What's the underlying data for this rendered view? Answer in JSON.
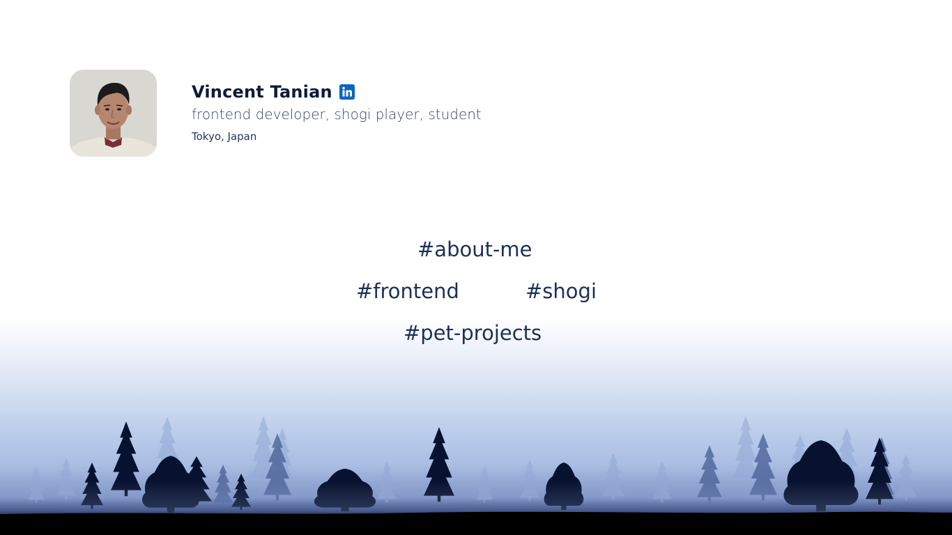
{
  "profile": {
    "name": "Vincent Tanian",
    "subtitle": "frontend developer, shogi player, student",
    "location": "Tokyo, Japan",
    "linkedin_icon": "linkedin-icon",
    "avatar_alt": "portrait photo"
  },
  "tags": {
    "about": "#about-me",
    "frontend": "#frontend",
    "shogi": "#shogi",
    "pet_projects": "#pet-projects"
  },
  "colors": {
    "text_dark": "#0d1b3a",
    "text_muted": "#34466d",
    "tag": "#1d2f58",
    "linkedin": "#0a66c2",
    "mist_blue": "#b7c9e8",
    "ground": "#000000"
  }
}
